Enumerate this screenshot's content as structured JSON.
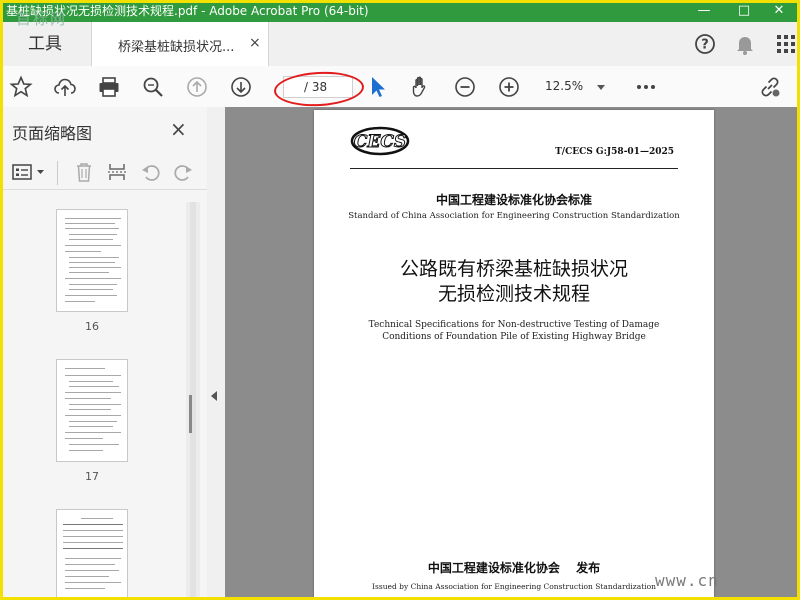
{
  "window": {
    "title": "基桩缺损状况无损检测技术规程.pdf - Adobe Acrobat Pro (64-bit)",
    "watermark": "首标网",
    "colors": {
      "titlebar": "#2f9a3e",
      "frame": "#f2e100",
      "annotation": "#e11d1d"
    }
  },
  "tabs": {
    "tools_label": "工具",
    "document_label": "桥梁基桩缺损状况...",
    "document_close": "×"
  },
  "toolbar": {
    "page_current": "",
    "page_total": "/ 38",
    "zoom": "12.5%",
    "icons": [
      "star-icon",
      "upload-icon",
      "print-icon",
      "zoom-search-icon",
      "prev-page-icon",
      "next-page-icon",
      "select-cursor-icon",
      "hand-icon",
      "zoom-out-icon",
      "zoom-in-icon",
      "more-icon",
      "link-icon"
    ]
  },
  "sidebar": {
    "title": "页面缩略图",
    "close": "×",
    "thumbnails": [
      {
        "page": "16"
      },
      {
        "page": "17"
      }
    ]
  },
  "document": {
    "standard_code": "T/CECS G:J58-01—2025",
    "org_cn": "中国工程建设标准化协会标准",
    "org_en": "Standard of China Association for Engineering Construction Standardization",
    "title_cn_line1": "公路既有桥梁基桩缺损状况",
    "title_cn_line2": "无损检测技术规程",
    "title_en_line1": "Technical Specifications for Non-destructive Testing of Damage",
    "title_en_line2": "Conditions of Foundation Pile of Existing Highway Bridge",
    "publisher_cn": "中国工程建设标准化协会 发布",
    "publisher_en": "Issued by China Association for Engineering Construction Standardization",
    "logo_text": "CECS"
  },
  "corner_watermark": "www.cn"
}
